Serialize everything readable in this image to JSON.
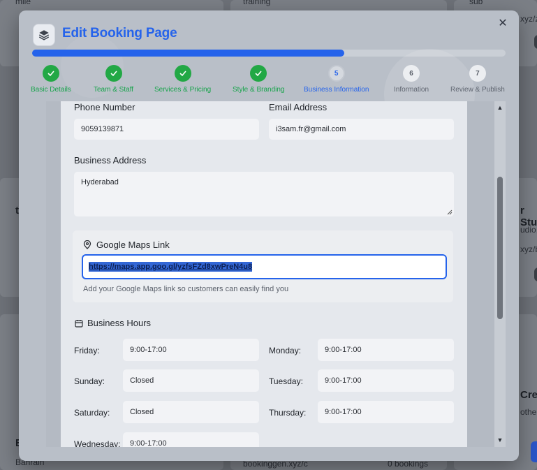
{
  "background": {
    "snippets": [
      "bookinggen.xyz/c",
      "0 bookings",
      "Bahrain",
      "mile",
      "training",
      "sub",
      "xyz/zo",
      "t",
      "r Stu",
      "udio,",
      "xyz/b",
      "Cre",
      "othe",
      "E"
    ]
  },
  "modal": {
    "title": "Edit Booking Page",
    "close_icon": "close-icon",
    "progress_percent": 66
  },
  "steps": [
    {
      "number": "1",
      "label": "Basic Details",
      "state": "done"
    },
    {
      "number": "2",
      "label": "Team & Staff",
      "state": "done"
    },
    {
      "number": "3",
      "label": "Services & Pricing",
      "state": "done"
    },
    {
      "number": "4",
      "label": "Style & Branding",
      "state": "done"
    },
    {
      "number": "5",
      "label": "Business Information",
      "state": "active"
    },
    {
      "number": "6",
      "label": "Information",
      "state": "todo"
    },
    {
      "number": "7",
      "label": "Review & Publish",
      "state": "todo"
    }
  ],
  "form": {
    "phone_label": "Phone Number",
    "phone_value": "9059139871",
    "email_label": "Email Address",
    "email_value": "i3sam.fr@gmail.com",
    "address_label": "Business Address",
    "address_value": "Hyderabad",
    "maps_label": "Google Maps Link",
    "maps_value": "https://maps.app.goo.gl/yzfsFZd8xwPreN4u8",
    "maps_help": "Add your Google Maps link so customers can easily find you",
    "hours_title": "Business Hours",
    "hours": [
      {
        "day": "Friday:",
        "value": "9:00-17:00"
      },
      {
        "day": "Monday:",
        "value": "9:00-17:00"
      },
      {
        "day": "Sunday:",
        "value": "Closed"
      },
      {
        "day": "Tuesday:",
        "value": "9:00-17:00"
      },
      {
        "day": "Saturday:",
        "value": "Closed"
      },
      {
        "day": "Thursday:",
        "value": "9:00-17:00"
      },
      {
        "day": "Wednesday:",
        "value": "9:00-17:00"
      }
    ]
  },
  "colors": {
    "accent": "#2563eb",
    "done": "#22a845"
  }
}
